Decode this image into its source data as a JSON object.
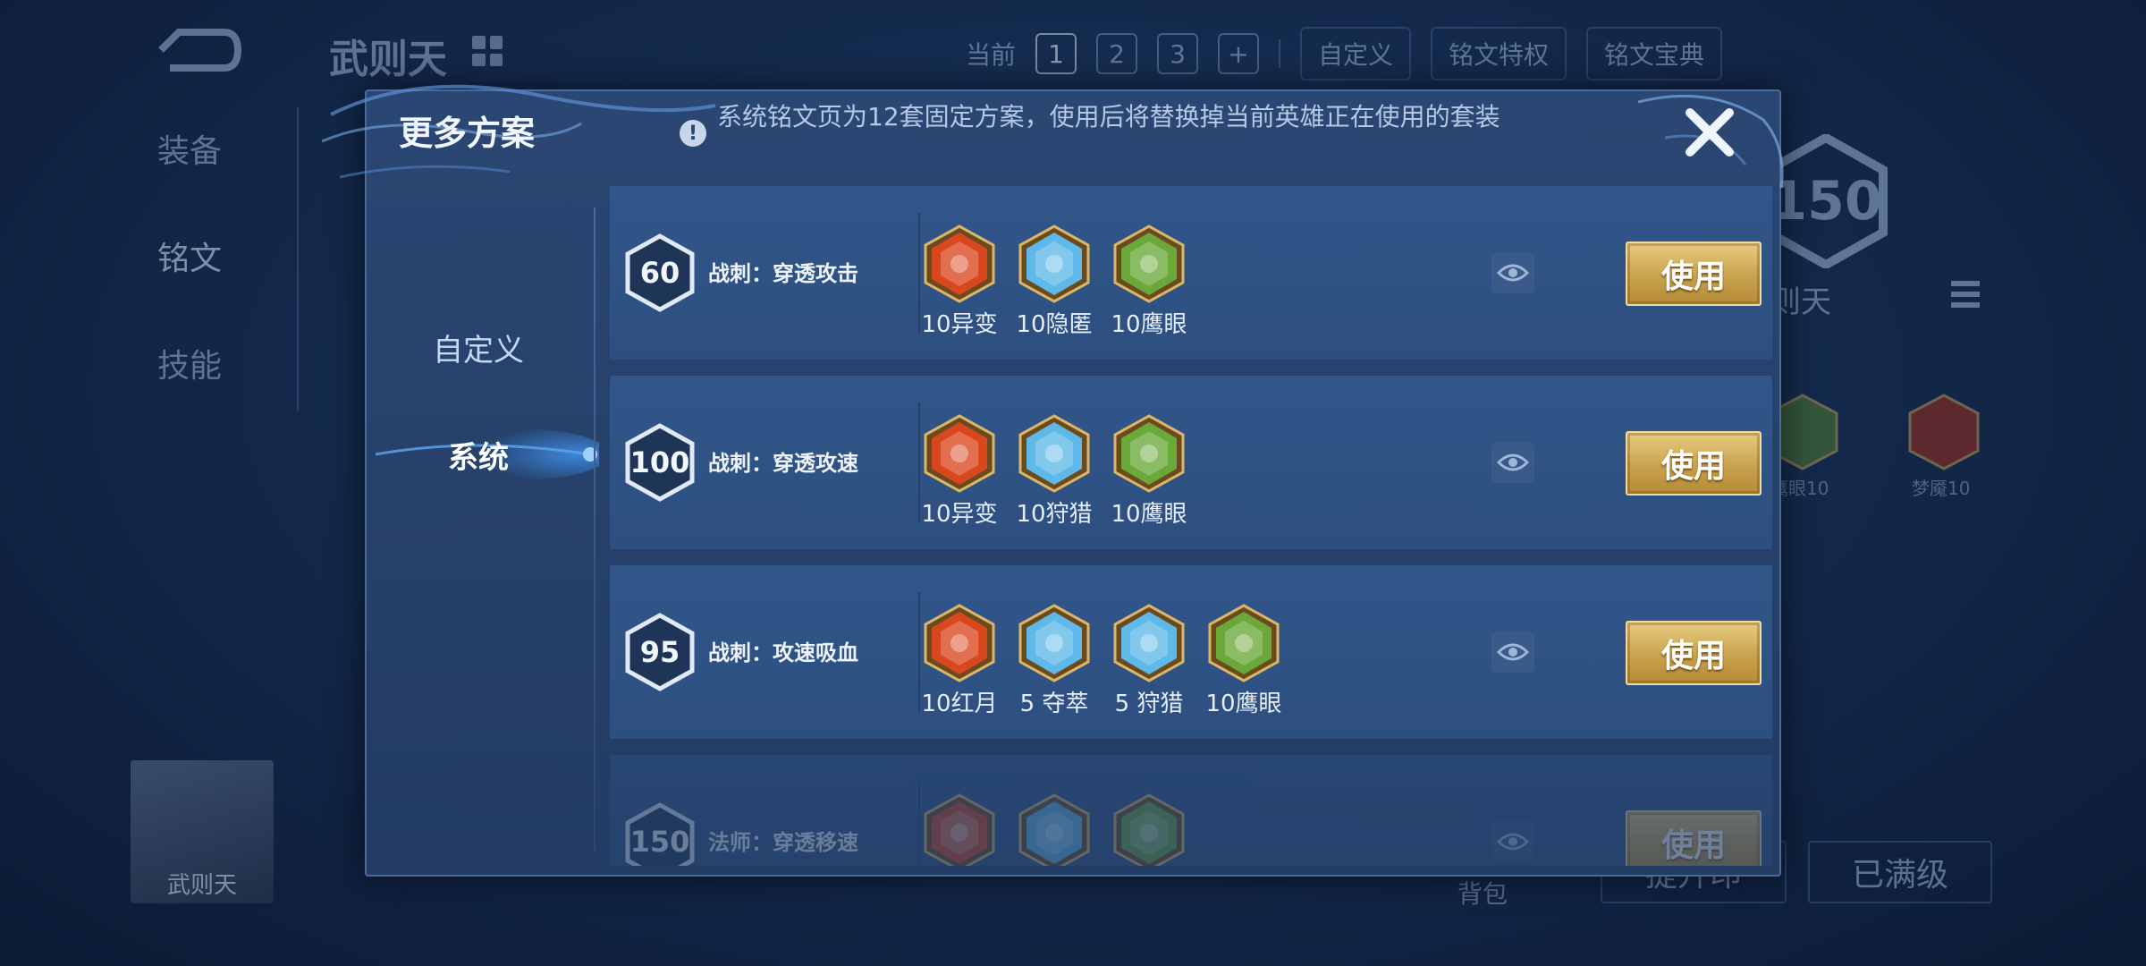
{
  "background": {
    "hero_name": "武则天",
    "topbar": {
      "current_label": "当前",
      "pages": [
        "1",
        "2",
        "3"
      ],
      "active_page": "1",
      "add_label": "+",
      "custom_label": "自定义",
      "privilege_label": "铭文特权",
      "guide_label": "铭文宝典"
    },
    "left_nav": {
      "equipment": "装备",
      "rune": "铭文",
      "skill": "技能"
    },
    "rune_level": "150",
    "hero_name_right": "则天",
    "avatar_name": "武则天",
    "rune_labels": [
      "鹰眼10",
      "梦魇10"
    ],
    "bag_label": "背包",
    "upgrade_label": "提升印",
    "maxed_label": "已满级"
  },
  "modal": {
    "title": "更多方案",
    "notice_icon": "!",
    "notice": "系统铭文页为12套固定方案，使用后将替换掉当前英雄正在使用的套装",
    "close_icon": "close-icon",
    "tabs": [
      {
        "label": "自定义",
        "active": false
      },
      {
        "label": "系统",
        "active": true
      }
    ],
    "use_label": "使用",
    "plans": [
      {
        "level": "60",
        "name": "战刺：穿透攻击",
        "runes": [
          {
            "label": "10异变",
            "icon": "yibian-rune",
            "color": "#d9471f"
          },
          {
            "label": "10隐匿",
            "icon": "yinni-rune",
            "color": "#5fb9e8"
          },
          {
            "label": "10鹰眼",
            "icon": "yingyan-rune",
            "color": "#6aa83a"
          }
        ]
      },
      {
        "level": "100",
        "name": "战刺：穿透攻速",
        "runes": [
          {
            "label": "10异变",
            "icon": "yibian-rune",
            "color": "#d9471f"
          },
          {
            "label": "10狩猎",
            "icon": "shoulie-rune",
            "color": "#5fb9e8"
          },
          {
            "label": "10鹰眼",
            "icon": "yingyan-rune",
            "color": "#6aa83a"
          }
        ]
      },
      {
        "level": "95",
        "name": "战刺：攻速吸血",
        "runes": [
          {
            "label": "10红月",
            "icon": "hongyue-rune",
            "color": "#d9471f"
          },
          {
            "label": "5 夺萃",
            "icon": "duocui-rune",
            "color": "#5fb9e8"
          },
          {
            "label": "5 狩猎",
            "icon": "shoulie-rune",
            "color": "#5fb9e8"
          },
          {
            "label": "10鹰眼",
            "icon": "yingyan-rune",
            "color": "#6aa83a"
          }
        ]
      },
      {
        "level": "150",
        "name": "法师：穿透移速",
        "runes": [
          {
            "label": "",
            "icon": "red-rune",
            "color": "#d9471f"
          },
          {
            "label": "",
            "icon": "blue-rune",
            "color": "#5fb9e8"
          },
          {
            "label": "",
            "icon": "green-rune",
            "color": "#6aa83a"
          }
        ]
      }
    ]
  }
}
